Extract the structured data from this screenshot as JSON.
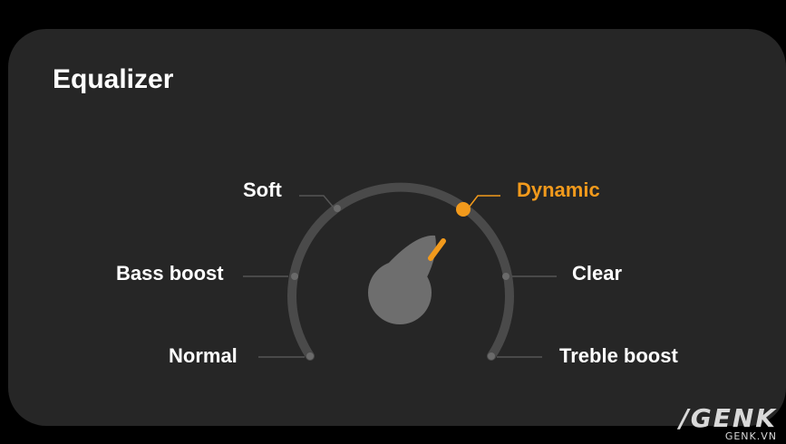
{
  "screen": {
    "title": "Equalizer"
  },
  "equalizer": {
    "options": [
      {
        "label": "Normal"
      },
      {
        "label": "Bass boost"
      },
      {
        "label": "Soft"
      },
      {
        "label": "Dynamic"
      },
      {
        "label": "Clear"
      },
      {
        "label": "Treble boost"
      }
    ],
    "selected": "Dynamic",
    "selected_index": 3
  },
  "watermark": {
    "brand": "/GENK",
    "sub": "GENK.VN"
  },
  "colors": {
    "background": "#000000",
    "panel": "#262626",
    "track": "#4a4a4a",
    "accent": "#f29a1c",
    "knob": "#6e6e6e"
  }
}
